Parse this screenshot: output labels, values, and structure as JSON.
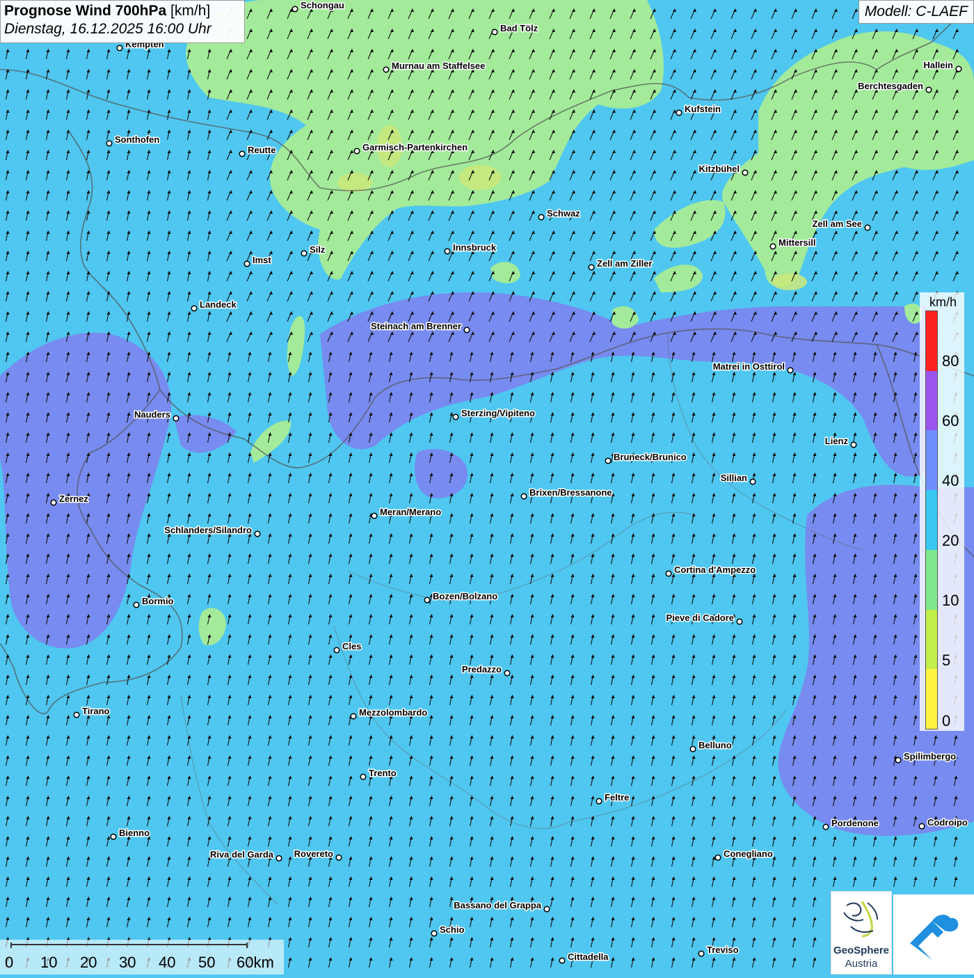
{
  "header": {
    "title_bold": "Prognose Wind 700hPa",
    "title_unit": " [km/h]",
    "datetime": "Dienstag, 16.12.2025 16:00 Uhr",
    "model": "Modell: C-LAEF"
  },
  "legend": {
    "unit": "km/h",
    "labels": [
      "80",
      "60",
      "40",
      "20",
      "10",
      "5",
      "0"
    ],
    "colors": [
      "#ff2020",
      "#ff2020",
      "#9a55ee",
      "#9a55ee",
      "#6f8fff",
      "#6f8fff",
      "#38c8f2",
      "#38c8f2",
      "#7ee98c",
      "#7ee98c",
      "#c3ef4a",
      "#c3ef4a",
      "#fff240",
      "#fff240"
    ]
  },
  "scale": {
    "labels": [
      "0",
      "10",
      "20",
      "30",
      "40",
      "50",
      "60km"
    ]
  },
  "logos": {
    "geosphere_name": "GeoSphere",
    "geosphere_sub": "Austria"
  },
  "colors": {
    "background": "#4fc7f0",
    "strong_wind": "#7b86f0",
    "weak_wind": "#a3eb9a",
    "weakest_wind": "#cbe87a"
  },
  "wind_direction": "from south to south-southwest",
  "cities": [
    {
      "name": "Schongau"
    },
    {
      "name": "Bad Tölz"
    },
    {
      "name": "Kempten"
    },
    {
      "name": "Murnau am Staffelsee"
    },
    {
      "name": "Hallein"
    },
    {
      "name": "Berchtesgaden"
    },
    {
      "name": "Kufstein"
    },
    {
      "name": "Sonthofen"
    },
    {
      "name": "Reutte"
    },
    {
      "name": "Garmisch-Partenkirchen"
    },
    {
      "name": "Kitzbühel"
    },
    {
      "name": "Schwaz"
    },
    {
      "name": "Zell am See"
    },
    {
      "name": "Silz"
    },
    {
      "name": "Innsbruck"
    },
    {
      "name": "Mittersill"
    },
    {
      "name": "Imst"
    },
    {
      "name": "Zell am Ziller"
    },
    {
      "name": "Landeck"
    },
    {
      "name": "Steinach am Brenner"
    },
    {
      "name": "Matrei in Osttirol"
    },
    {
      "name": "Nauders"
    },
    {
      "name": "Sterzing/Vipiteno"
    },
    {
      "name": "Lienz"
    },
    {
      "name": "Bruneck/Brunico"
    },
    {
      "name": "Sillian"
    },
    {
      "name": "Brixen/Bressanone"
    },
    {
      "name": "Zernez"
    },
    {
      "name": "Meran/Merano"
    },
    {
      "name": "Schlanders/Silandro"
    },
    {
      "name": "Cortina d'Ampezzo"
    },
    {
      "name": "Bozen/Bolzano"
    },
    {
      "name": "Bormio"
    },
    {
      "name": "Pieve di Cadore"
    },
    {
      "name": "Cles"
    },
    {
      "name": "Predazzo"
    },
    {
      "name": "Tirano"
    },
    {
      "name": "Mezzolombardo"
    },
    {
      "name": "Belluno"
    },
    {
      "name": "Spilimbergo"
    },
    {
      "name": "Trento"
    },
    {
      "name": "Feltre"
    },
    {
      "name": "Pordenone"
    },
    {
      "name": "Codroipo"
    },
    {
      "name": "Bienno"
    },
    {
      "name": "Riva del Garda"
    },
    {
      "name": "Rovereto"
    },
    {
      "name": "Conegliano"
    },
    {
      "name": "Bassano del Grappa"
    },
    {
      "name": "Schio"
    },
    {
      "name": "Treviso"
    },
    {
      "name": "Cittadella"
    }
  ]
}
